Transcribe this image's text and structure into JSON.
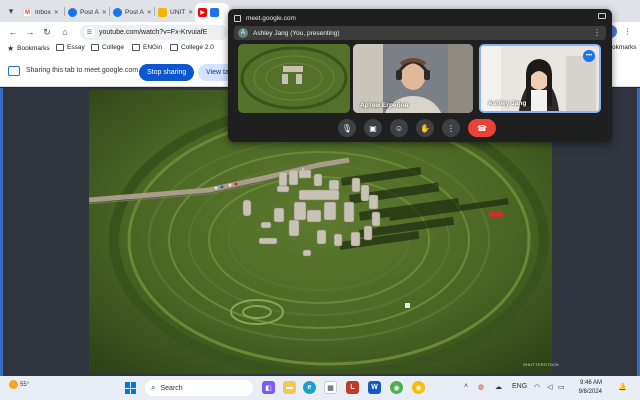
{
  "browser": {
    "tabs": [
      {
        "title": "Inbox",
        "favicon_color": "#ea4335",
        "favicon_letter": "M",
        "active": false
      },
      {
        "title": "Post A",
        "favicon_color": "#1a73e8",
        "favicon_letter": "",
        "active": false
      },
      {
        "title": "Post A",
        "favicon_color": "#1a73e8",
        "favicon_letter": "",
        "active": false
      },
      {
        "title": "UNIT",
        "favicon_color": "#f4b400",
        "favicon_letter": "",
        "active": false
      },
      {
        "title": "",
        "favicon_color": "#ff0000",
        "favicon_letter": "",
        "active": true
      }
    ],
    "url": "youtube.com/watch?v=Fx-KrvuiafE",
    "bookmarks": [
      {
        "label": "Bookmarks",
        "type": "star"
      },
      {
        "label": "Essay",
        "type": "folder"
      },
      {
        "label": "College",
        "type": "folder"
      },
      {
        "label": "ENGin",
        "type": "folder"
      },
      {
        "label": "College 2.0",
        "type": "folder"
      }
    ],
    "bookmarks_right": "okmarks"
  },
  "share_bar": {
    "message": "Sharing this tab to meet.google.com",
    "stop_label": "Stop sharing",
    "view_label": "View tal"
  },
  "meet": {
    "domain": "meet.google.com",
    "presenter_initial": "A",
    "presenter_label": "Ashley Jang (You, presenting)",
    "participants": [
      {
        "name": "",
        "kind": "screen-share"
      },
      {
        "name": "Артем Егребов",
        "kind": "camera"
      },
      {
        "name": "Ashley Jang",
        "kind": "camera",
        "highlighted": true
      }
    ],
    "controls": [
      "microphone",
      "camera",
      "reactions",
      "raise-hand",
      "more",
      "leave-call"
    ]
  },
  "video": {
    "watermark": "SHUTTERSTOCK",
    "accent_color": "#3b6bc5"
  },
  "taskbar": {
    "temperature": "55°",
    "search_placeholder": "Search",
    "language": "ENG",
    "time": "9:46 AM",
    "date": "9/8/2024"
  }
}
